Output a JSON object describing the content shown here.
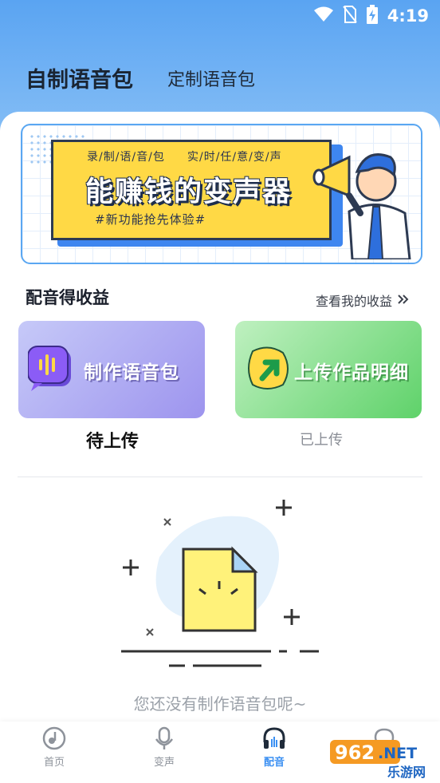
{
  "status": {
    "time": "4:19",
    "icons": [
      "wifi-icon",
      "no-sim-icon",
      "battery-charging-icon"
    ]
  },
  "tabs": [
    {
      "label": "自制语音包",
      "active": true
    },
    {
      "label": "定制语音包",
      "active": false
    }
  ],
  "banner": {
    "subtitle_left": "录/制/语/音/包",
    "subtitle_right": "实/时/任/意/变/声",
    "title": "能赚钱的变声器",
    "tag": "#新功能抢先体验#"
  },
  "earnings": {
    "title": "配音得收益",
    "link": "查看我的收益"
  },
  "cards": [
    {
      "label": "制作语音包",
      "icon": "voice-pack-icon"
    },
    {
      "label": "上传作品明细",
      "icon": "upload-arrow-icon"
    }
  ],
  "subtabs": [
    {
      "label": "待上传",
      "active": true
    },
    {
      "label": "已上传",
      "active": false
    }
  ],
  "empty": {
    "text": "您还没有制作语音包呢~"
  },
  "nav": [
    {
      "label": "首页",
      "icon": "music-disc-icon",
      "active": false
    },
    {
      "label": "变声",
      "icon": "microphone-icon",
      "active": false
    },
    {
      "label": "配音",
      "icon": "headphones-icon",
      "active": true
    },
    {
      "label": "",
      "icon": "chat-icon",
      "active": false
    }
  ],
  "watermark": {
    "text": "962.NET",
    "sub": "乐游网"
  },
  "colors": {
    "accent": "#3a8ff2",
    "header": "#5aa4f2",
    "banner_yellow": "#ffd945",
    "card_purple": "#9d94ee",
    "card_green": "#5fd26a"
  }
}
